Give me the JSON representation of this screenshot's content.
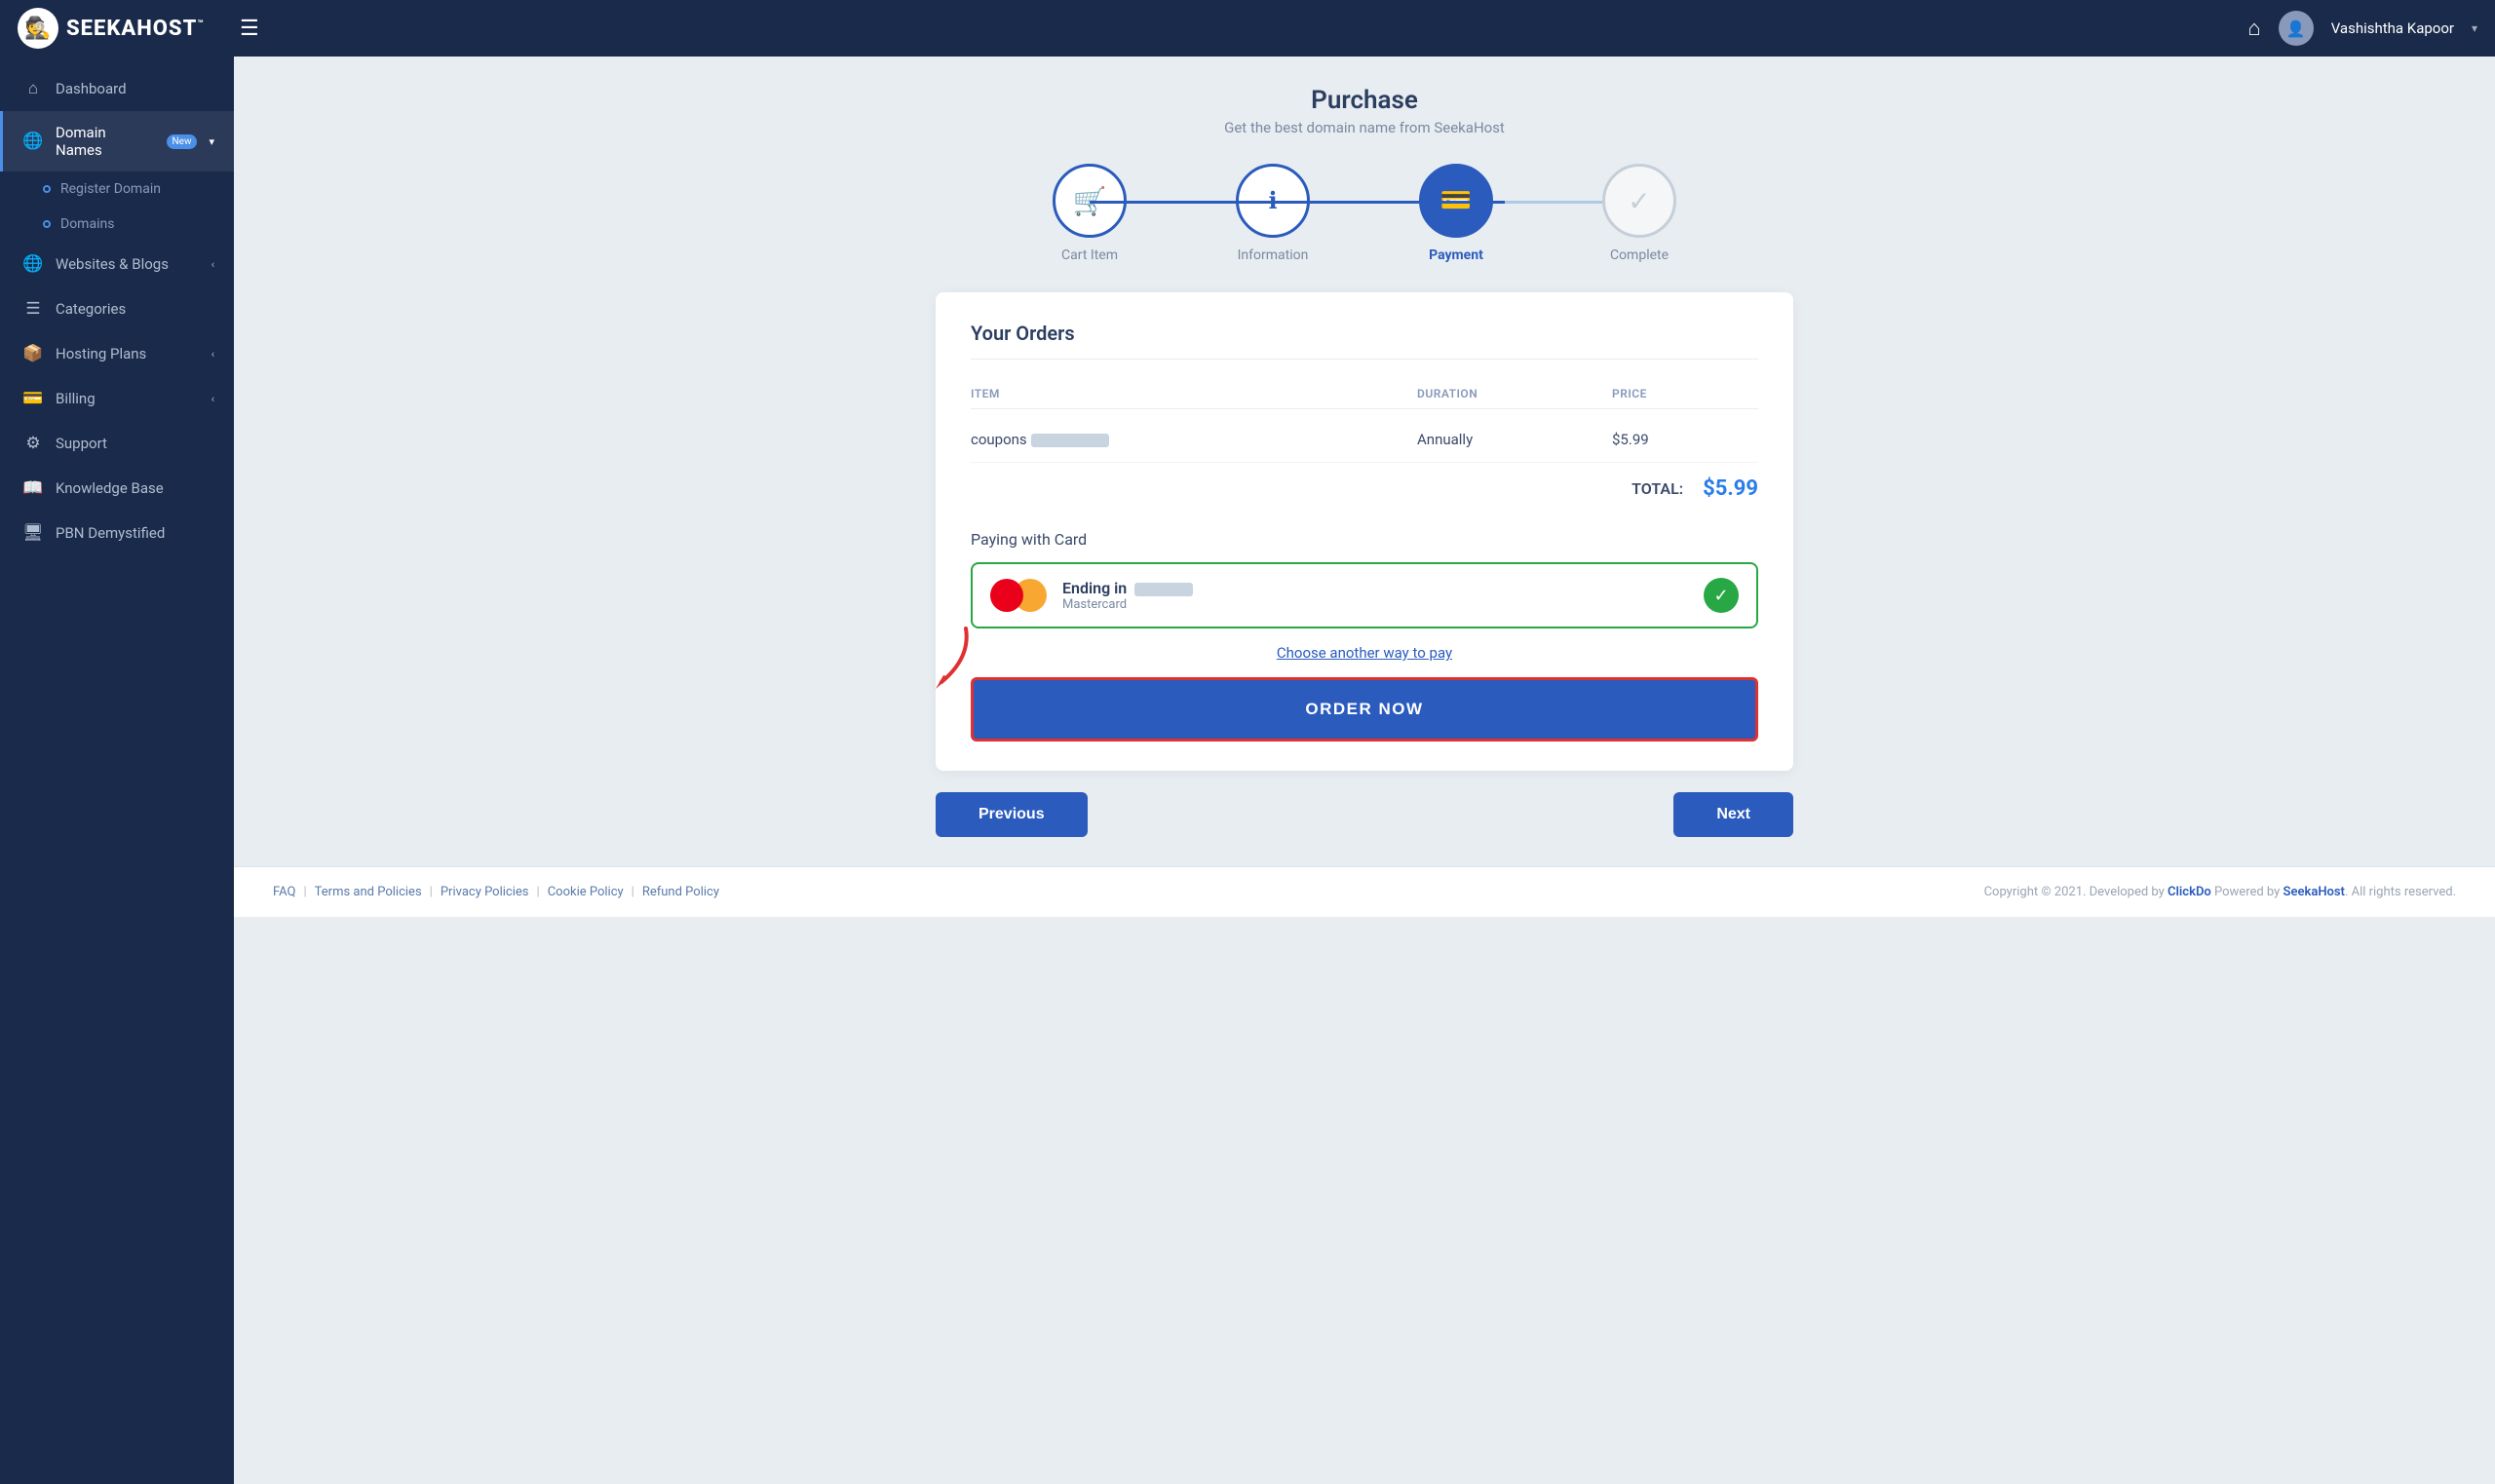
{
  "topbar": {
    "logo_text": "SEEKAHOST",
    "logo_tm": "™",
    "logo_emoji": "🕵️",
    "hamburger_label": "☰",
    "home_icon": "⌂",
    "user_name": "Vashishtha Kapoor",
    "user_chevron": "▾"
  },
  "sidebar": {
    "items": [
      {
        "id": "dashboard",
        "icon": "⌂",
        "label": "Dashboard",
        "active": false
      },
      {
        "id": "domain-names",
        "icon": "🌐",
        "label": "Domain Names",
        "badge": "New",
        "active": true,
        "chevron": "▾"
      },
      {
        "id": "register-domain",
        "label": "Register Domain",
        "sub": true
      },
      {
        "id": "domains",
        "label": "Domains",
        "sub": true
      },
      {
        "id": "websites-blogs",
        "icon": "🌐",
        "label": "Websites & Blogs",
        "chevron": "‹"
      },
      {
        "id": "categories",
        "icon": "☰",
        "label": "Categories"
      },
      {
        "id": "hosting-plans",
        "icon": "📦",
        "label": "Hosting Plans",
        "chevron": "‹"
      },
      {
        "id": "billing",
        "icon": "💳",
        "label": "Billing",
        "chevron": "‹"
      },
      {
        "id": "support",
        "icon": "⚙",
        "label": "Support"
      },
      {
        "id": "knowledge-base",
        "icon": "📖",
        "label": "Knowledge Base"
      },
      {
        "id": "pbn-demystified",
        "icon": "🖥",
        "label": "PBN Demystified"
      }
    ]
  },
  "purchase": {
    "title": "Purchase",
    "subtitle": "Get the best domain name from SeekaHost"
  },
  "steps": [
    {
      "id": "cart-item",
      "label": "Cart Item",
      "icon": "🛒",
      "state": "completed"
    },
    {
      "id": "information",
      "label": "Information",
      "icon": "ℹ",
      "state": "completed"
    },
    {
      "id": "payment",
      "label": "Payment",
      "icon": "💳",
      "state": "active"
    },
    {
      "id": "complete",
      "label": "Complete",
      "icon": "✓",
      "state": "inactive"
    }
  ],
  "orders": {
    "title": "Your Orders",
    "table_headers": {
      "item": "ITEM",
      "duration": "DURATION",
      "price": "PRICE"
    },
    "rows": [
      {
        "item_prefix": "coupons",
        "item_blurred": true,
        "duration": "Annually",
        "price": "$5.99"
      }
    ],
    "total_label": "TOTAL:",
    "total_amount": "$5.99"
  },
  "payment": {
    "paying_with_label": "Paying with Card",
    "card_ending_label": "Ending in",
    "card_type": "Mastercard",
    "choose_another": "Choose another way to pay",
    "order_now_label": "ORDER NOW"
  },
  "navigation": {
    "previous_label": "Previous",
    "next_label": "Next"
  },
  "footer": {
    "links": [
      {
        "label": "FAQ"
      },
      {
        "label": "Terms and Policies"
      },
      {
        "label": "Privacy Policies"
      },
      {
        "label": "Cookie Policy"
      },
      {
        "label": "Refund Policy"
      }
    ],
    "copyright_prefix": "Copyright © 2021. Developed by ",
    "clickdo": "ClickDo",
    "copyright_middle": " Powered by ",
    "seekahost": "SeekaHost",
    "copyright_suffix": ". All rights reserved."
  }
}
